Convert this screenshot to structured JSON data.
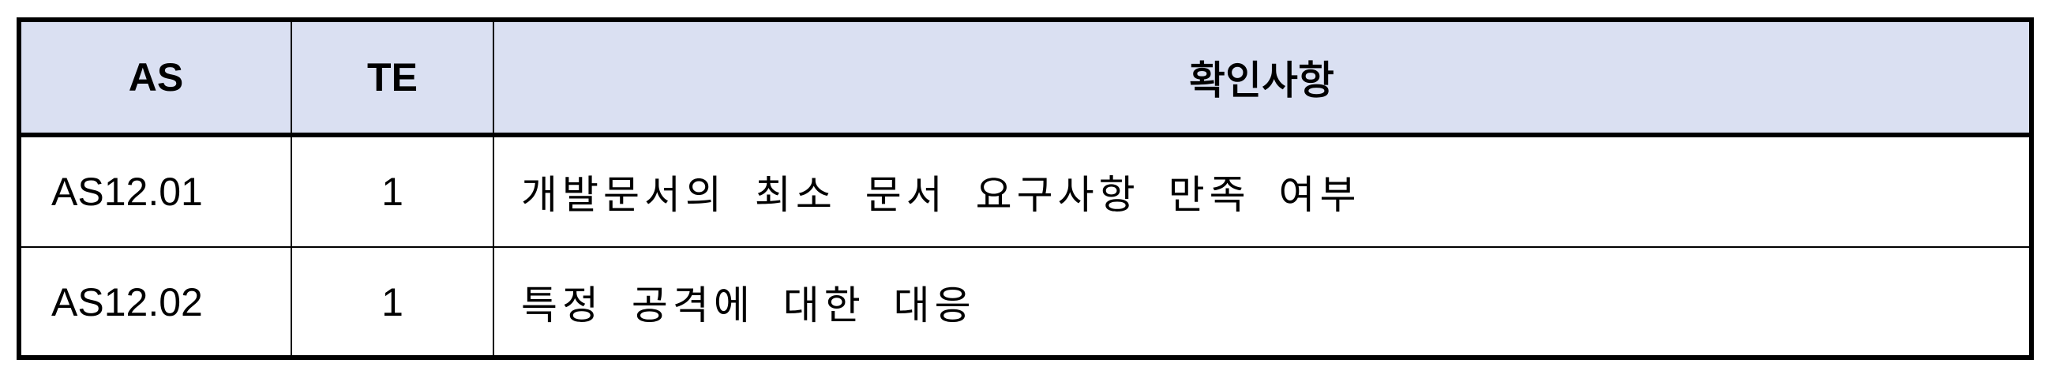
{
  "table": {
    "headers": [
      "AS",
      "TE",
      "확인사항"
    ],
    "rows": [
      [
        "AS12.01",
        "1",
        "개발문서의 최소 문서 요구사항 만족 여부"
      ],
      [
        "AS12.02",
        "1",
        "특정 공격에 대한 대응"
      ]
    ]
  },
  "colors": {
    "header_background": "#dae0f2",
    "border": "#000000"
  }
}
